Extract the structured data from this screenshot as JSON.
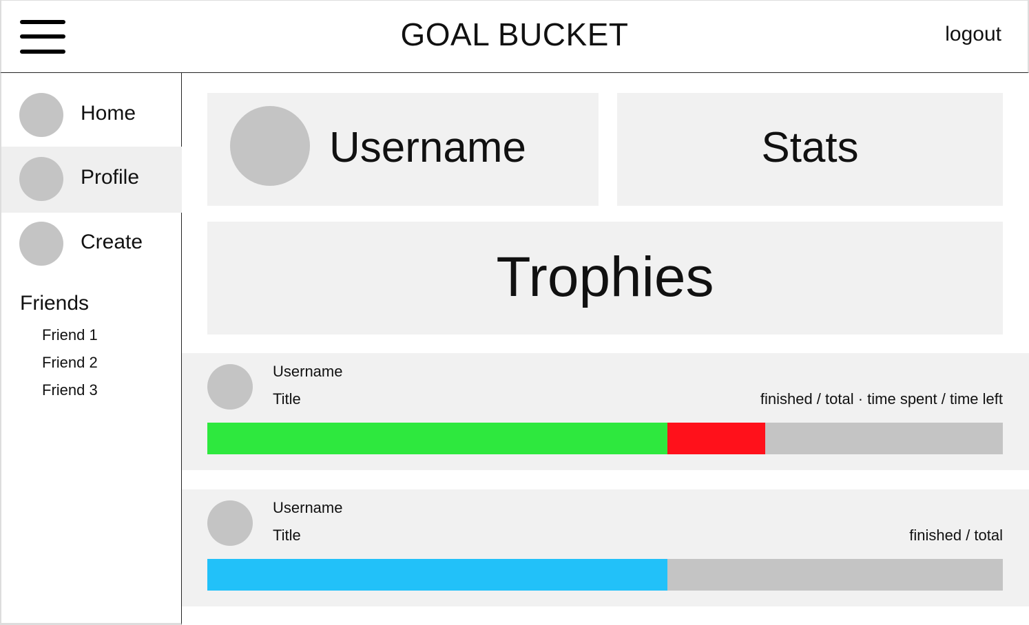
{
  "header": {
    "title": "GOAL BUCKET",
    "logout_label": "logout"
  },
  "sidebar": {
    "items": [
      {
        "label": "Home",
        "active": false
      },
      {
        "label": "Profile",
        "active": true
      },
      {
        "label": "Create",
        "active": false
      }
    ],
    "friends_heading": "Friends",
    "friends": [
      "Friend 1",
      "Friend 2",
      "Friend 3"
    ]
  },
  "profile": {
    "username": "Username",
    "stats_label": "Stats",
    "trophies_label": "Trophies"
  },
  "goals": [
    {
      "username": "Username",
      "title": "Title",
      "meta": "finished / total · time spent / time left",
      "segments": [
        {
          "fraction": 0.578,
          "color": "#2ee83e"
        },
        {
          "fraction": 0.123,
          "color": "#ff111b"
        }
      ]
    },
    {
      "username": "Username",
      "title": "Title",
      "meta": "finished / total",
      "segments": [
        {
          "fraction": 0.578,
          "color": "#22c1f9"
        }
      ]
    }
  ],
  "colors": {
    "panel": "#f1f1f1",
    "placeholder": "#c4c4c4",
    "bar_track": "#c4c4c4"
  }
}
